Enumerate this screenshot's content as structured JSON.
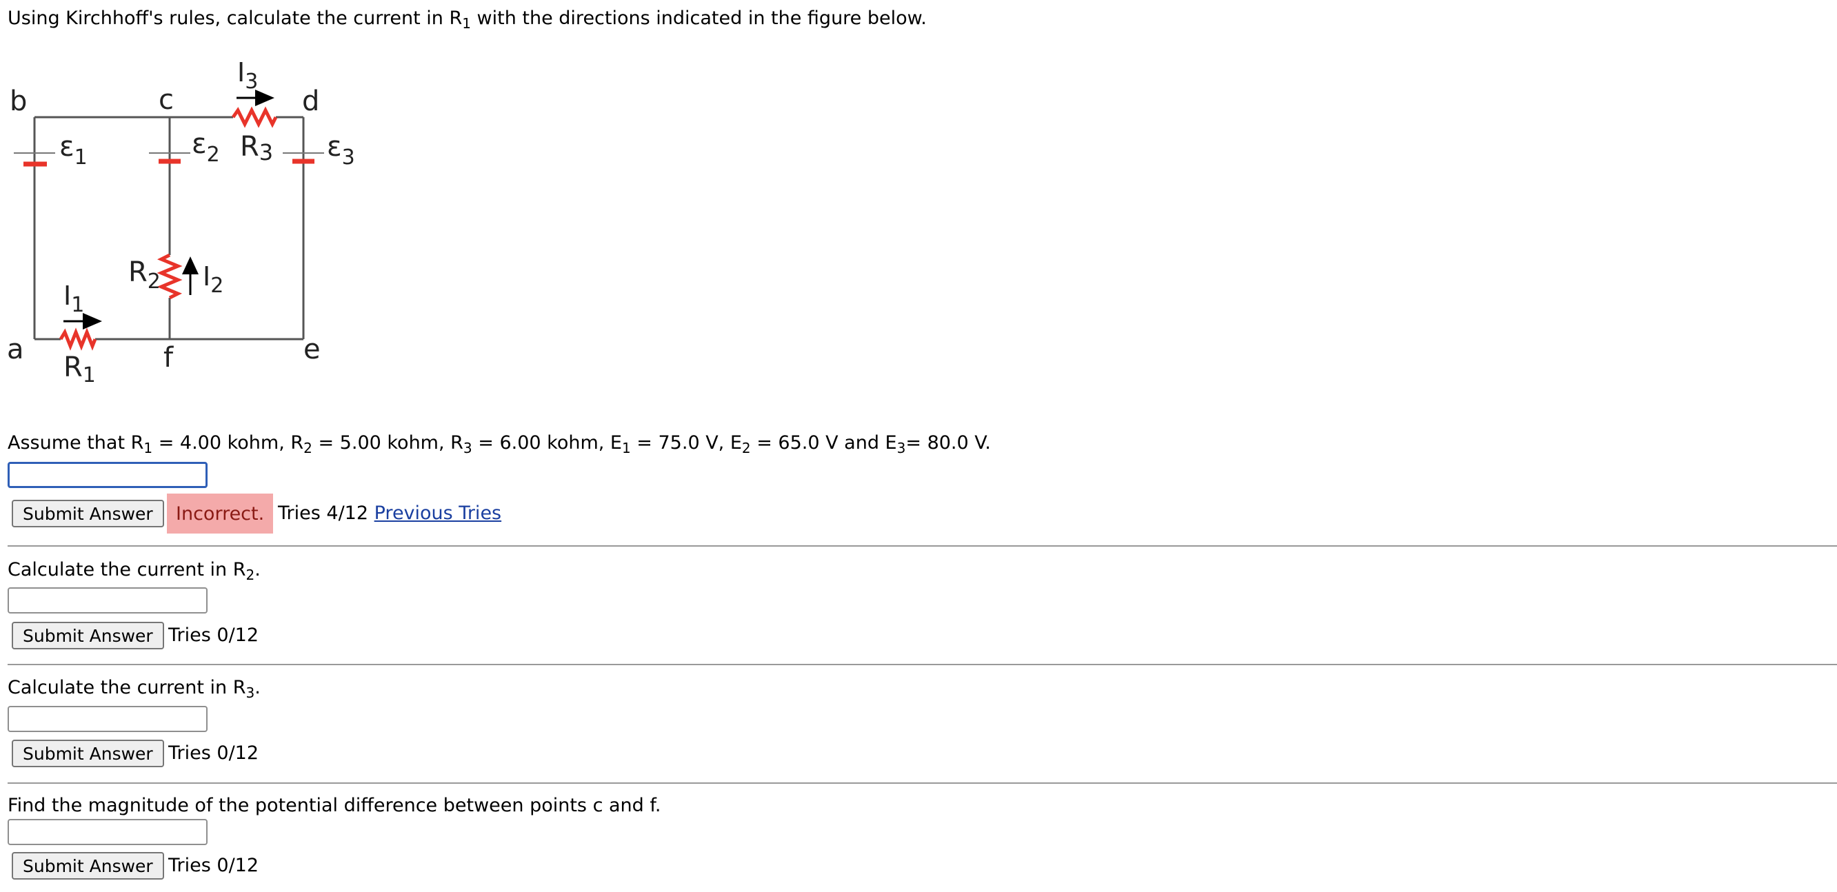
{
  "question1": {
    "prompt_prefix": "Using Kirchhoff's rules, calculate the current in R",
    "prompt_sub": "1",
    "prompt_suffix": " with the directions indicated in the figure below.",
    "assume_parts": [
      {
        "text": "Assume that R",
        "sub": "1"
      },
      {
        "text": " = 4.00 kohm, R",
        "sub": "2"
      },
      {
        "text": " = 5.00 kohm, R",
        "sub": "3"
      },
      {
        "text": " = 6.00 kohm, E",
        "sub": "1"
      },
      {
        "text": " = 75.0 V, E",
        "sub": "2"
      },
      {
        "text": " = 65.0 V and E",
        "sub": "3"
      },
      {
        "text": "= 80.0 V.",
        "sub": ""
      }
    ],
    "answer_value": "",
    "submit_label": "Submit Answer",
    "status": "Incorrect.",
    "tries": "Tries 4/12",
    "previous_tries_link": "Previous Tries"
  },
  "figure": {
    "nodes": {
      "b": "b",
      "c": "c",
      "d": "d",
      "a": "a",
      "f": "f",
      "e": "e"
    },
    "emf": [
      {
        "symbol": "ε",
        "sub": "1"
      },
      {
        "symbol": "ε",
        "sub": "2"
      },
      {
        "symbol": "ε",
        "sub": "3"
      }
    ],
    "resistors": [
      {
        "symbol": "R",
        "sub": "1"
      },
      {
        "symbol": "R",
        "sub": "2"
      },
      {
        "symbol": "R",
        "sub": "3"
      }
    ],
    "currents": [
      {
        "symbol": "I",
        "sub": "1"
      },
      {
        "symbol": "I",
        "sub": "2"
      },
      {
        "symbol": "I",
        "sub": "3"
      }
    ],
    "colors": {
      "wire": "#555555",
      "component": "#e8342a",
      "arrow": "#000000"
    }
  },
  "question2": {
    "prompt_prefix": "Calculate the current in R",
    "prompt_sub": "2",
    "prompt_suffix": ".",
    "answer_value": "",
    "submit_label": "Submit Answer",
    "tries": "Tries 0/12"
  },
  "question3": {
    "prompt_prefix": "Calculate the current in R",
    "prompt_sub": "3",
    "prompt_suffix": ".",
    "answer_value": "",
    "submit_label": "Submit Answer",
    "tries": "Tries 0/12"
  },
  "question4": {
    "prompt": "Find the magnitude of the potential difference between points c and f.",
    "answer_value": "",
    "submit_label": "Submit Answer",
    "tries": "Tries 0/12"
  }
}
